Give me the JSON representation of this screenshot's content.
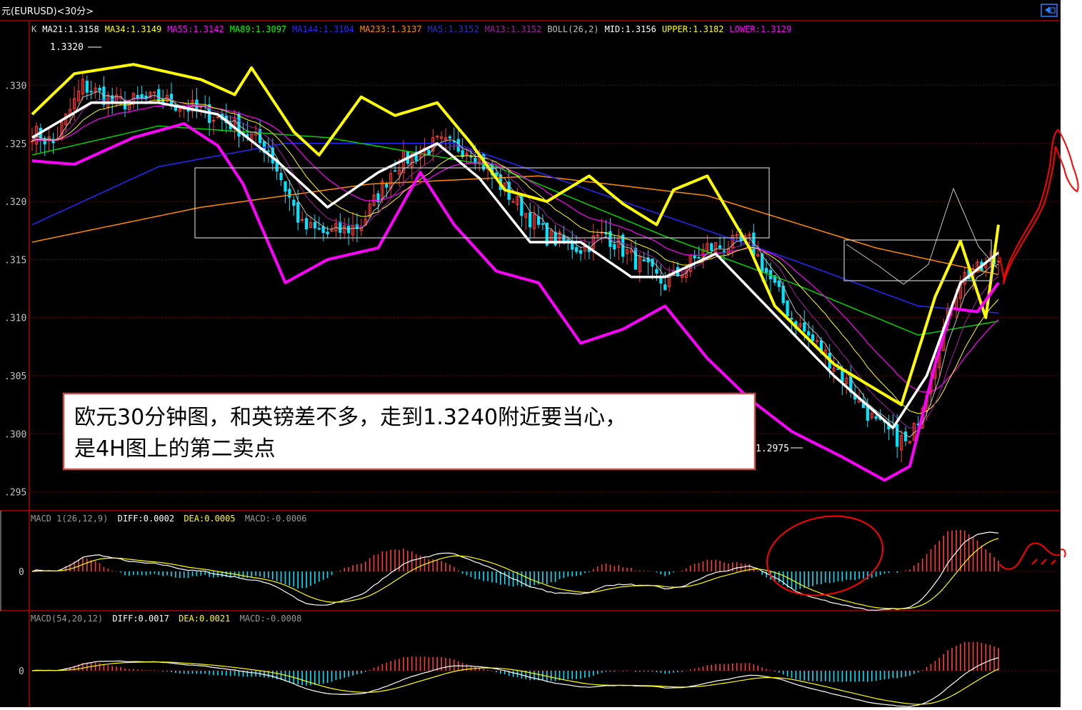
{
  "window": {
    "title": "元(EURUSD)<30分>",
    "icon": "window-restore-icon"
  },
  "main_panel": {
    "indicator_line": [
      {
        "key": "k",
        "text": "K",
        "color": "#c0c0c0"
      },
      {
        "key": "ma21",
        "text": "MA21:1.3158",
        "color": "#ffffff"
      },
      {
        "key": "ma34",
        "text": "MA34:1.3149",
        "color": "#ffff00"
      },
      {
        "key": "ma55",
        "text": "MA55:1.3142",
        "color": "#ff00ff"
      },
      {
        "key": "ma89",
        "text": "MA89:1.3097",
        "color": "#00ff00"
      },
      {
        "key": "ma144",
        "text": "MA144:1.3104",
        "color": "#2828ff"
      },
      {
        "key": "ma233",
        "text": "MA233:1.3137",
        "color": "#ff8c00"
      },
      {
        "key": "ma5",
        "text": "MA5:1.3152",
        "color": "#3030c8"
      },
      {
        "key": "ma13",
        "text": "MA13:1.3152",
        "color": "#a020a0"
      },
      {
        "key": "boll",
        "text": "BOLL(26,2)",
        "color": "#c0c0c0"
      },
      {
        "key": "mid",
        "text": "MID:1.3156",
        "color": "#ffffff"
      },
      {
        "key": "upper",
        "text": "UPPER:1.3182",
        "color": "#ffff00"
      },
      {
        "key": "lower",
        "text": "LOWER:1.3129",
        "color": "#ff00ff"
      }
    ],
    "high_label": "1.3320",
    "low_label": "1.2975",
    "y_axis_labels": [
      ".330",
      ".325",
      ".320",
      ".315",
      ".310",
      ".305",
      ".300",
      ".295"
    ],
    "y_axis_values": [
      1.33,
      1.325,
      1.32,
      1.315,
      1.31,
      1.305,
      1.3,
      1.295
    ]
  },
  "annotation": {
    "line1": "欧元30分钟图，和英镑差不多，走到1.3240附近要当心，",
    "line2": "是4H图上的第二卖点"
  },
  "macd1": {
    "label": "MACD 1(26,12,9)",
    "diff": "DIFF:0.0002",
    "dea": "DEA:0.0005",
    "macd": "MACD:-0.0006",
    "zero_label": "0"
  },
  "macd2": {
    "label": "MACD(54,20,12)",
    "diff": "DIFF:0.0017",
    "dea": "DEA:0.0021",
    "macd": "MACD:-0.0008",
    "zero_label": "0"
  },
  "chart_data": {
    "type": "line",
    "title": "",
    "ylim": [
      1.2935,
      1.3355
    ],
    "bars_count": 230,
    "key_points": [
      {
        "i": 0,
        "v": 1.326
      },
      {
        "i": 5,
        "v": 1.325
      },
      {
        "i": 12,
        "v": 1.33
      },
      {
        "i": 20,
        "v": 1.3285
      },
      {
        "i": 30,
        "v": 1.3288
      },
      {
        "i": 40,
        "v": 1.3278
      },
      {
        "i": 48,
        "v": 1.3266
      },
      {
        "i": 56,
        "v": 1.3245
      },
      {
        "i": 64,
        "v": 1.3178
      },
      {
        "i": 70,
        "v": 1.3172
      },
      {
        "i": 78,
        "v": 1.318
      },
      {
        "i": 86,
        "v": 1.3232
      },
      {
        "i": 96,
        "v": 1.325
      },
      {
        "i": 104,
        "v": 1.3245
      },
      {
        "i": 112,
        "v": 1.321
      },
      {
        "i": 122,
        "v": 1.317
      },
      {
        "i": 130,
        "v": 1.316
      },
      {
        "i": 136,
        "v": 1.3172
      },
      {
        "i": 142,
        "v": 1.3152
      },
      {
        "i": 150,
        "v": 1.3128
      },
      {
        "i": 160,
        "v": 1.316
      },
      {
        "i": 170,
        "v": 1.3165
      },
      {
        "i": 180,
        "v": 1.31
      },
      {
        "i": 190,
        "v": 1.306
      },
      {
        "i": 200,
        "v": 1.3008
      },
      {
        "i": 208,
        "v": 1.299
      },
      {
        "i": 212,
        "v": 1.304
      },
      {
        "i": 216,
        "v": 1.309
      },
      {
        "i": 220,
        "v": 1.3135
      },
      {
        "i": 224,
        "v": 1.314
      },
      {
        "i": 229,
        "v": 1.315
      }
    ],
    "boll_upper_points": [
      {
        "i": 0,
        "v": 1.3275
      },
      {
        "i": 10,
        "v": 1.331
      },
      {
        "i": 24,
        "v": 1.3318
      },
      {
        "i": 40,
        "v": 1.3305
      },
      {
        "i": 48,
        "v": 1.3292
      },
      {
        "i": 52,
        "v": 1.3315
      },
      {
        "i": 62,
        "v": 1.326
      },
      {
        "i": 68,
        "v": 1.324
      },
      {
        "i": 78,
        "v": 1.329
      },
      {
        "i": 86,
        "v": 1.3274
      },
      {
        "i": 96,
        "v": 1.3285
      },
      {
        "i": 104,
        "v": 1.325
      },
      {
        "i": 112,
        "v": 1.321
      },
      {
        "i": 122,
        "v": 1.32
      },
      {
        "i": 132,
        "v": 1.3222
      },
      {
        "i": 140,
        "v": 1.3198
      },
      {
        "i": 148,
        "v": 1.318
      },
      {
        "i": 152,
        "v": 1.321
      },
      {
        "i": 160,
        "v": 1.3222
      },
      {
        "i": 170,
        "v": 1.316
      },
      {
        "i": 176,
        "v": 1.311
      },
      {
        "i": 190,
        "v": 1.306
      },
      {
        "i": 206,
        "v": 1.3025
      },
      {
        "i": 214,
        "v": 1.3118
      },
      {
        "i": 220,
        "v": 1.3166
      },
      {
        "i": 226,
        "v": 1.31
      },
      {
        "i": 229,
        "v": 1.318
      }
    ],
    "boll_lower_points": [
      {
        "i": 0,
        "v": 1.3235
      },
      {
        "i": 10,
        "v": 1.3232
      },
      {
        "i": 24,
        "v": 1.3255
      },
      {
        "i": 36,
        "v": 1.3267
      },
      {
        "i": 44,
        "v": 1.3248
      },
      {
        "i": 50,
        "v": 1.3215
      },
      {
        "i": 60,
        "v": 1.313
      },
      {
        "i": 70,
        "v": 1.315
      },
      {
        "i": 82,
        "v": 1.316
      },
      {
        "i": 92,
        "v": 1.3225
      },
      {
        "i": 100,
        "v": 1.318
      },
      {
        "i": 110,
        "v": 1.314
      },
      {
        "i": 120,
        "v": 1.313
      },
      {
        "i": 130,
        "v": 1.3078
      },
      {
        "i": 140,
        "v": 1.309
      },
      {
        "i": 150,
        "v": 1.311
      },
      {
        "i": 160,
        "v": 1.3065
      },
      {
        "i": 170,
        "v": 1.303
      },
      {
        "i": 180,
        "v": 1.3002
      },
      {
        "i": 192,
        "v": 1.298
      },
      {
        "i": 202,
        "v": 1.296
      },
      {
        "i": 208,
        "v": 1.2972
      },
      {
        "i": 214,
        "v": 1.306
      },
      {
        "i": 218,
        "v": 1.3108
      },
      {
        "i": 224,
        "v": 1.3105
      },
      {
        "i": 229,
        "v": 1.313
      }
    ],
    "boll_mid_points": [
      {
        "i": 0,
        "v": 1.3255
      },
      {
        "i": 14,
        "v": 1.3285
      },
      {
        "i": 30,
        "v": 1.3285
      },
      {
        "i": 44,
        "v": 1.3275
      },
      {
        "i": 58,
        "v": 1.3235
      },
      {
        "i": 70,
        "v": 1.3195
      },
      {
        "i": 82,
        "v": 1.3225
      },
      {
        "i": 96,
        "v": 1.325
      },
      {
        "i": 106,
        "v": 1.322
      },
      {
        "i": 118,
        "v": 1.3165
      },
      {
        "i": 130,
        "v": 1.3165
      },
      {
        "i": 142,
        "v": 1.3135
      },
      {
        "i": 150,
        "v": 1.3135
      },
      {
        "i": 162,
        "v": 1.3155
      },
      {
        "i": 174,
        "v": 1.311
      },
      {
        "i": 190,
        "v": 1.305
      },
      {
        "i": 204,
        "v": 1.3005
      },
      {
        "i": 212,
        "v": 1.305
      },
      {
        "i": 220,
        "v": 1.313
      },
      {
        "i": 229,
        "v": 1.3156
      }
    ],
    "ma144_points": [
      {
        "i": 0,
        "v": 1.318
      },
      {
        "i": 30,
        "v": 1.323
      },
      {
        "i": 60,
        "v": 1.325
      },
      {
        "i": 100,
        "v": 1.325
      },
      {
        "i": 140,
        "v": 1.32
      },
      {
        "i": 180,
        "v": 1.315
      },
      {
        "i": 210,
        "v": 1.311
      },
      {
        "i": 229,
        "v": 1.3104
      }
    ],
    "ma233_points": [
      {
        "i": 0,
        "v": 1.3165
      },
      {
        "i": 40,
        "v": 1.3195
      },
      {
        "i": 80,
        "v": 1.3215
      },
      {
        "i": 120,
        "v": 1.3222
      },
      {
        "i": 160,
        "v": 1.3205
      },
      {
        "i": 200,
        "v": 1.316
      },
      {
        "i": 229,
        "v": 1.3137
      }
    ],
    "ma89_points": [
      {
        "i": 0,
        "v": 1.324
      },
      {
        "i": 30,
        "v": 1.3265
      },
      {
        "i": 70,
        "v": 1.3255
      },
      {
        "i": 110,
        "v": 1.323
      },
      {
        "i": 150,
        "v": 1.317
      },
      {
        "i": 180,
        "v": 1.313
      },
      {
        "i": 210,
        "v": 1.3085
      },
      {
        "i": 229,
        "v": 1.3097
      }
    ]
  }
}
